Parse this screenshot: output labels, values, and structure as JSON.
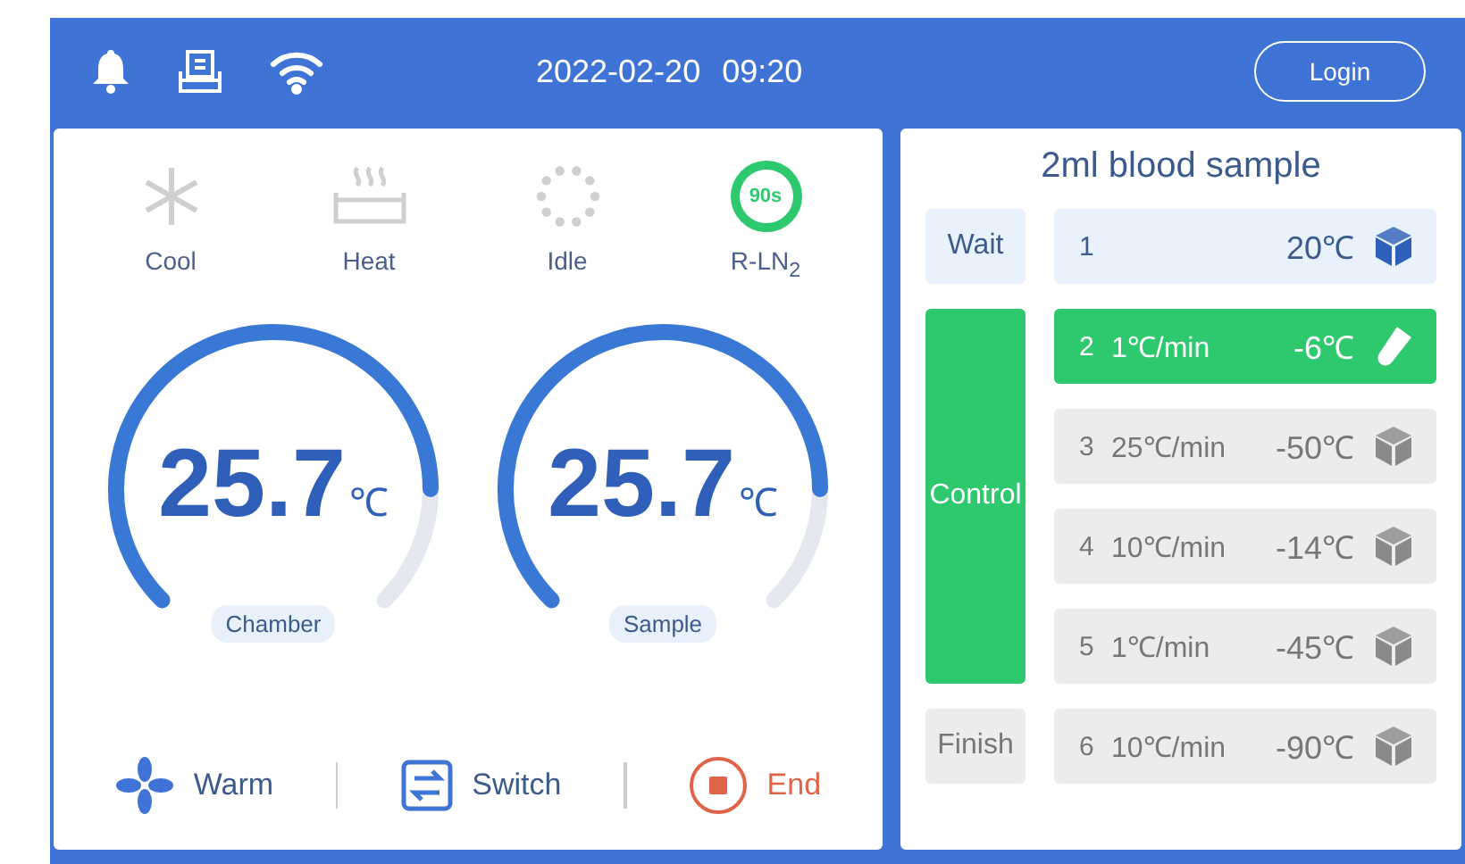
{
  "header": {
    "date": "2022-02-20",
    "time": "09:20",
    "login": "Login"
  },
  "modes": [
    {
      "kind": "cool",
      "label": "Cool",
      "active": false
    },
    {
      "kind": "heat",
      "label": "Heat",
      "active": false
    },
    {
      "kind": "idle",
      "label": "Idle",
      "active": false
    },
    {
      "kind": "timer",
      "label": "R-LN$_{2}$",
      "active": true,
      "timer": "90s"
    }
  ],
  "gauges": [
    {
      "value": "25.7",
      "unit": "℃",
      "label": "Chamber"
    },
    {
      "value": "25.7",
      "unit": "℃",
      "label": "Sample"
    }
  ],
  "actions": [
    {
      "kind": "fan",
      "label": "Warm"
    },
    {
      "kind": "switch",
      "label": "Switch"
    },
    {
      "kind": "stop",
      "label": "End"
    }
  ],
  "program": {
    "title": "2ml blood sample",
    "phases": [
      {
        "label": "Wait",
        "done": true,
        "active": false,
        "steps": [
          {
            "number": "1",
            "temp": "20℃",
            "done": true,
            "active": false
          }
        ]
      },
      {
        "label": "Control",
        "done": false,
        "active": true,
        "steps": [
          {
            "number": "2",
            "rate": "1℃/min",
            "temp": "-6℃",
            "done": false,
            "active": true
          },
          {
            "number": "3",
            "rate": "25℃/min",
            "temp": "-50℃",
            "done": false,
            "active": false
          },
          {
            "number": "4",
            "rate": "10℃/min",
            "temp": "-14℃",
            "done": false,
            "active": false
          },
          {
            "number": "5",
            "rate": "1℃/min",
            "temp": "-45℃",
            "done": false,
            "active": false
          }
        ]
      },
      {
        "label": "Finish",
        "done": false,
        "active": false,
        "steps": [
          {
            "number": "6",
            "rate": "10℃/min",
            "temp": "-90℃",
            "done": false,
            "active": false
          }
        ]
      }
    ]
  }
}
